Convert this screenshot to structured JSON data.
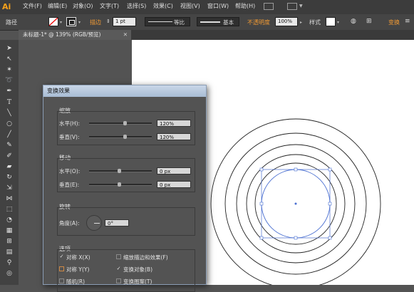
{
  "app": {
    "logo": "Ai"
  },
  "menu": [
    {
      "label": "文件(F)"
    },
    {
      "label": "编辑(E)"
    },
    {
      "label": "对象(O)"
    },
    {
      "label": "文字(T)"
    },
    {
      "label": "选择(S)"
    },
    {
      "label": "效果(C)"
    },
    {
      "label": "视图(V)"
    },
    {
      "label": "窗口(W)"
    },
    {
      "label": "帮助(H)"
    }
  ],
  "control_bar": {
    "object_type": "路径",
    "stroke_label": "描边",
    "stroke_weight": "1 pt",
    "stroke_profile": "等比",
    "brush": "基本",
    "opacity_label": "不透明度",
    "opacity_value": "100%",
    "style_label": "样式",
    "transform_label": "变换"
  },
  "document_tab": {
    "title": "未标题-1* @ 139% (RGB/预览)"
  },
  "dialog": {
    "title": "变换效果",
    "scale": {
      "title": "缩放",
      "horizontal_label": "水平(H):",
      "horizontal_value": "120%",
      "vertical_label": "垂直(V):",
      "vertical_value": "120%"
    },
    "move": {
      "title": "移动",
      "horizontal_label": "水平(O):",
      "horizontal_value": "0 px",
      "vertical_label": "垂直(E):",
      "vertical_value": "0 px"
    },
    "rotate": {
      "title": "旋转",
      "angle_label": "角度(A):",
      "angle_value": "0°"
    },
    "options": {
      "title": "选项",
      "reflect_x": "对称 X(X)",
      "reflect_y": "对称 Y(Y)",
      "random": "随机(R)",
      "scale_strokes": "缩放描边和效果(F)",
      "transform_objects": "变换对象(B)",
      "transform_patterns": "变换图案(T)"
    }
  },
  "colors": {
    "accent": "#f19a34",
    "selection": "#4a6fd1"
  }
}
